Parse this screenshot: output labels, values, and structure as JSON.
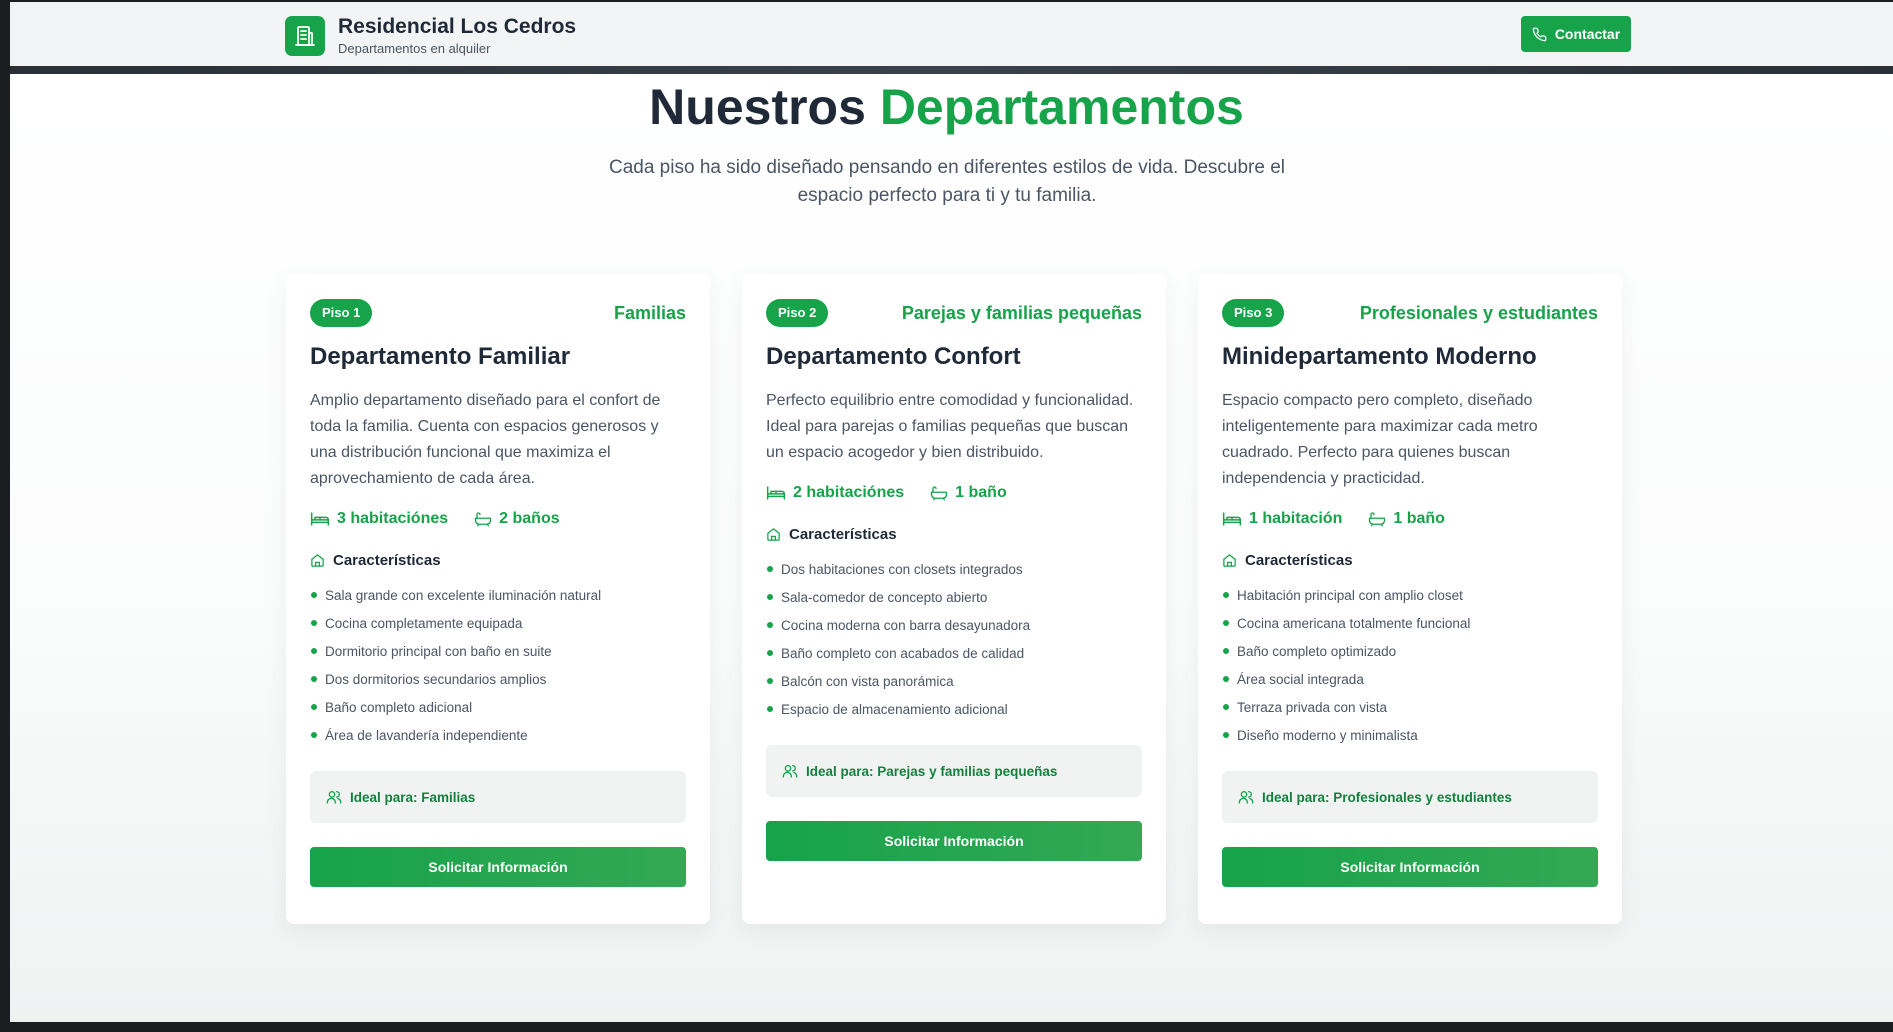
{
  "brand": {
    "title": "Residencial Los Cedros",
    "subtitle": "Departamentos en alquiler",
    "icon": "building-icon"
  },
  "header": {
    "contact_label": "Contactar",
    "contact_icon": "phone-icon"
  },
  "hero": {
    "title_plain": "Nuestros",
    "title_accent": "Departamentos",
    "subtitle": "Cada piso ha sido diseñado pensando en diferentes estilos de vida. Descubre el espacio perfecto para ti y tu familia."
  },
  "colors": {
    "accent": "#16a34a",
    "text": "#1f2937",
    "muted": "#4b5563",
    "ideal_bg": "#f0f3f2"
  },
  "cards": [
    {
      "floor": "Piso 1",
      "audience": "Familias",
      "title": "Departamento Familiar",
      "description": "Amplio departamento diseñado para el confort de toda la familia. Cuenta con espacios generosos y una distribución funcional que maximiza el aprovechamiento de cada área.",
      "rooms": "3 habitaciónes",
      "baths": "2 baños",
      "features_title": "Características",
      "features": [
        "Sala grande con excelente iluminación natural",
        "Cocina completamente equipada",
        "Dormitorio principal con baño en suite",
        "Dos dormitorios secundarios amplios",
        "Baño completo adicional",
        "Área de lavandería independiente"
      ],
      "ideal": "Ideal para: Familias",
      "cta": "Solicitar Información"
    },
    {
      "floor": "Piso 2",
      "audience": "Parejas y familias pequeñas",
      "title": "Departamento Confort",
      "description": "Perfecto equilibrio entre comodidad y funcionalidad. Ideal para parejas o familias pequeñas que buscan un espacio acogedor y bien distribuido.",
      "rooms": "2 habitaciónes",
      "baths": "1 baño",
      "features_title": "Características",
      "features": [
        "Dos habitaciones con closets integrados",
        "Sala-comedor de concepto abierto",
        "Cocina moderna con barra desayunadora",
        "Baño completo con acabados de calidad",
        "Balcón con vista panorámica",
        "Espacio de almacenamiento adicional"
      ],
      "ideal": "Ideal para: Parejas y familias pequeñas",
      "cta": "Solicitar Información"
    },
    {
      "floor": "Piso 3",
      "audience": "Profesionales y estudiantes",
      "title": "Minidepartamento Moderno",
      "description": "Espacio compacto pero completo, diseñado inteligentemente para maximizar cada metro cuadrado. Perfecto para quienes buscan independencia y practicidad.",
      "rooms": "1 habitación",
      "baths": "1 baño",
      "features_title": "Características",
      "features": [
        "Habitación principal con amplio closet",
        "Cocina americana totalmente funcional",
        "Baño completo optimizado",
        "Área social integrada",
        "Terraza privada con vista",
        "Diseño moderno y minimalista"
      ],
      "ideal": "Ideal para: Profesionales y estudiantes",
      "cta": "Solicitar Información"
    }
  ]
}
